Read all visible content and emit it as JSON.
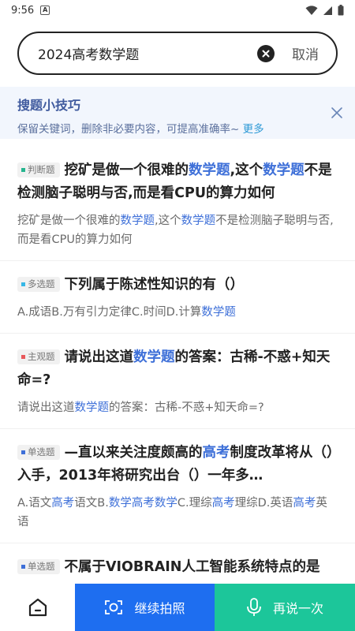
{
  "status": {
    "time": "9:56",
    "notif_letter": "A"
  },
  "search": {
    "query": "2024高考数学题",
    "cancel_label": "取消"
  },
  "tips": {
    "title": "搜题小技巧",
    "desc": "保留关键词，删除非必要内容，可提高准确率~",
    "more": "更多"
  },
  "results": [
    {
      "badge": "判断题",
      "badge_color": "#26b58f",
      "title": [
        {
          "t": "挖矿是做一个很难的"
        },
        {
          "t": "数学题",
          "hl": true
        },
        {
          "t": ",这个"
        },
        {
          "t": "数学题",
          "hl": true
        },
        {
          "t": "不是检测脑子聪明与否,而是看CPU的算力如何"
        }
      ],
      "desc": [
        {
          "t": "挖矿是做一个很难的"
        },
        {
          "t": "数学题",
          "hl": true
        },
        {
          "t": ",这个"
        },
        {
          "t": "数学题",
          "hl": true
        },
        {
          "t": "不是检测脑子聪明与否,而是看CPU的算力如何"
        }
      ]
    },
    {
      "badge": "多选题",
      "badge_color": "#37b7e6",
      "title": [
        {
          "t": "下列属于陈述性知识的有（）"
        }
      ],
      "desc": [
        {
          "t": "A.成语B.万有引力定律C.时间D.计算"
        },
        {
          "t": "数学题",
          "hl": true
        }
      ]
    },
    {
      "badge": "主观题",
      "badge_color": "#e8585b",
      "title": [
        {
          "t": "请说出这道"
        },
        {
          "t": "数学题",
          "hl": true
        },
        {
          "t": "的答案：古稀-不惑+知天命=?"
        }
      ],
      "desc": [
        {
          "t": "请说出这道"
        },
        {
          "t": "数学题",
          "hl": true
        },
        {
          "t": "的答案：古稀-不惑+知天命=?"
        }
      ]
    },
    {
      "badge": "单选题",
      "badge_color": "#3d6fd8",
      "title": [
        {
          "t": "—直以来关注度颇高的"
        },
        {
          "t": "高考",
          "hl": true
        },
        {
          "t": "制度改革将从（）入手，2013年将研究出台（）一年多…"
        }
      ],
      "desc": [
        {
          "t": "A.语文"
        },
        {
          "t": "高考",
          "hl": true
        },
        {
          "t": "语文B."
        },
        {
          "t": "数学高考数学",
          "hl": true
        },
        {
          "t": "C.理综"
        },
        {
          "t": "高考",
          "hl": true
        },
        {
          "t": "理综D.英语"
        },
        {
          "t": "高考",
          "hl": true
        },
        {
          "t": "英语"
        }
      ]
    },
    {
      "badge": "单选题",
      "badge_color": "#3d6fd8",
      "title": [
        {
          "t": "不属于VIOBRAIN人工智能系统特点的是"
        }
      ],
      "desc": []
    }
  ],
  "bottom": {
    "photo_label": "继续拍照",
    "voice_label": "再说一次"
  },
  "colors": {
    "highlight": "#3d6fd8",
    "photo": "#1e6ef0",
    "voice": "#1cc69a"
  },
  "icons": [
    "wifi-icon",
    "signal-icon",
    "battery-icon",
    "clear-icon",
    "close-icon",
    "home-icon",
    "camera-icon",
    "microphone-icon"
  ]
}
